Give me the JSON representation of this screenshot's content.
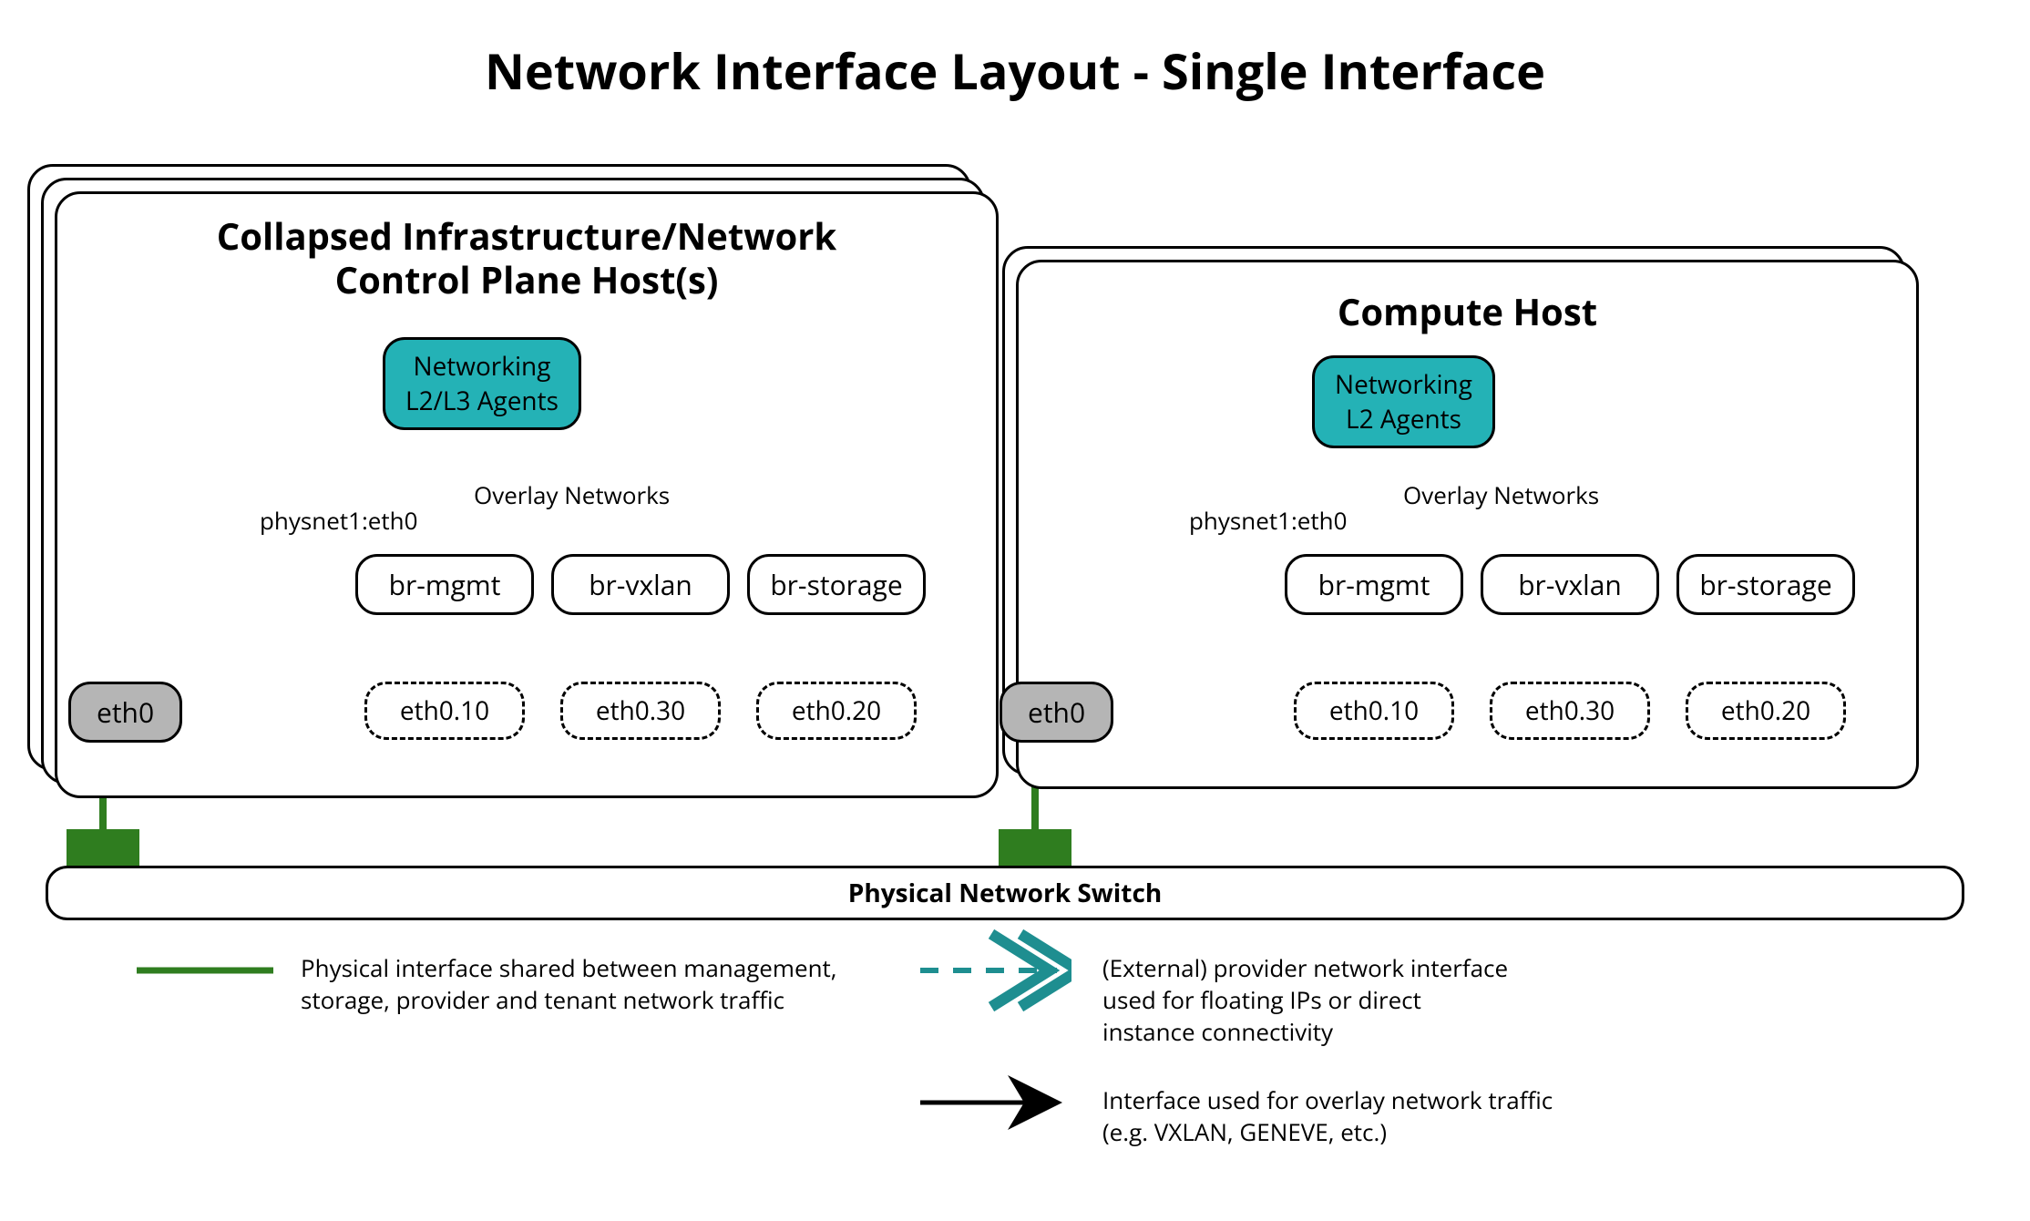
{
  "title": "Network Interface Layout - Single Interface",
  "infra": {
    "title_line1": "Collapsed Infrastructure/Network",
    "title_line2": "Control Plane Host(s)",
    "agent_line1": "Networking",
    "agent_line2": "L2/L3 Agents",
    "label_physnet": "physnet1:eth0",
    "label_overlay": "Overlay Networks",
    "br_mgmt": "br-mgmt",
    "br_vxlan": "br-vxlan",
    "br_storage": "br-storage",
    "eth0": "eth0",
    "eth0_10": "eth0.10",
    "eth0_30": "eth0.30",
    "eth0_20": "eth0.20"
  },
  "compute": {
    "title": "Compute Host",
    "agent_line1": "Networking",
    "agent_line2": "L2 Agents",
    "label_physnet": "physnet1:eth0",
    "label_overlay": "Overlay Networks",
    "br_mgmt": "br-mgmt",
    "br_vxlan": "br-vxlan",
    "br_storage": "br-storage",
    "eth0": "eth0",
    "eth0_10": "eth0.10",
    "eth0_30": "eth0.30",
    "eth0_20": "eth0.20"
  },
  "switch": "Physical Network Switch",
  "legend": {
    "green_line1": "Physical interface shared between management,",
    "green_line2": "storage, provider and tenant network traffic",
    "teal_line1": "(External) provider network interface",
    "teal_line2": "used for floating IPs or direct",
    "teal_line3": "instance connectivity",
    "black_line1": "Interface used for overlay network traffic",
    "black_line2": "(e.g. VXLAN, GENEVE, etc.)"
  }
}
